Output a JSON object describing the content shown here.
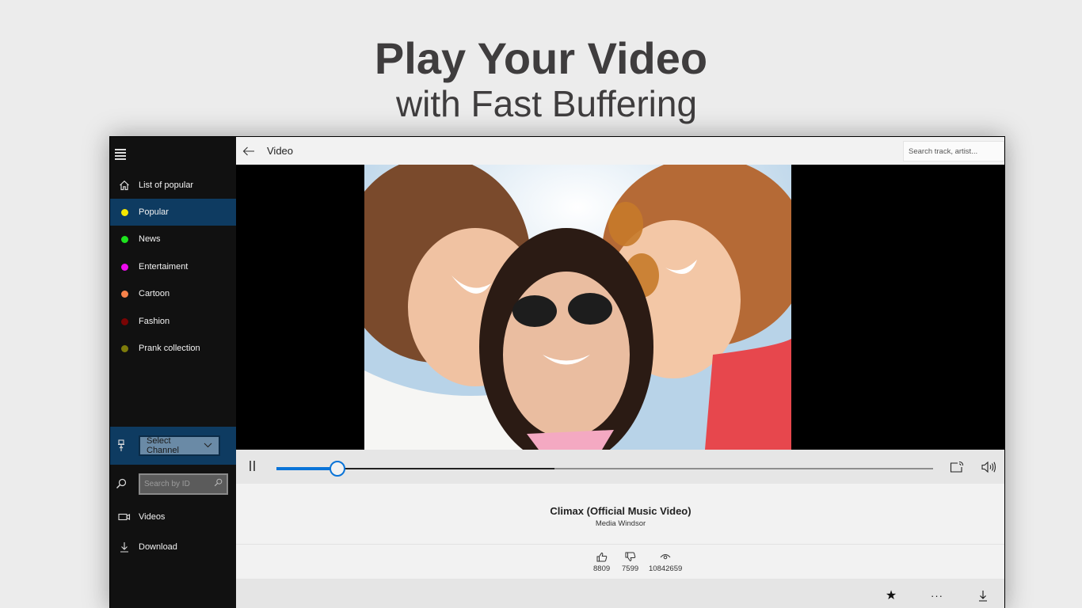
{
  "promo": {
    "headline": "Play Your Video",
    "subheadline": "with Fast Buffering"
  },
  "sidebar": {
    "menu_icon": "hamburger-icon",
    "header_item": {
      "label": "List of popular",
      "icon": "home-icon"
    },
    "categories": [
      {
        "label": "Popular",
        "color": "#f5e700",
        "active": true
      },
      {
        "label": "News",
        "color": "#1ee31e",
        "active": false
      },
      {
        "label": "Entertaiment",
        "color": "#ee0aee",
        "active": false
      },
      {
        "label": "Cartoon",
        "color": "#f7824a",
        "active": false
      },
      {
        "label": "Fashion",
        "color": "#7a0404",
        "active": false
      },
      {
        "label": "Prank collection",
        "color": "#7d7b0a",
        "active": false
      }
    ],
    "channel_select": {
      "icon": "pin-icon",
      "value": "Select Channel"
    },
    "search_id": {
      "icon": "search-icon",
      "placeholder": "Search by ID",
      "value": ""
    },
    "bottom_items": [
      {
        "label": "Videos",
        "icon": "video-camera-icon"
      },
      {
        "label": "Download",
        "icon": "download-icon"
      }
    ],
    "accent_color": "#0e3b61"
  },
  "topbar": {
    "back_icon": "back-arrow-icon",
    "title": "Video",
    "search_placeholder": "Search track, artist...",
    "search_value": ""
  },
  "player": {
    "state": "playing",
    "played_fraction": 0.093,
    "buffered_fraction": 0.423,
    "accent_color": "#0a74d8",
    "buttons": [
      "pause-icon",
      "cast-icon",
      "volume-icon"
    ]
  },
  "video": {
    "title": "Climax (Official Music Video)",
    "channel": "Media Windsor",
    "likes": "8809",
    "dislikes": "7599",
    "views": "10842659"
  },
  "actions": {
    "favorite_icon": "star-icon",
    "more_icon": "more-icon",
    "download_icon": "download-icon"
  }
}
